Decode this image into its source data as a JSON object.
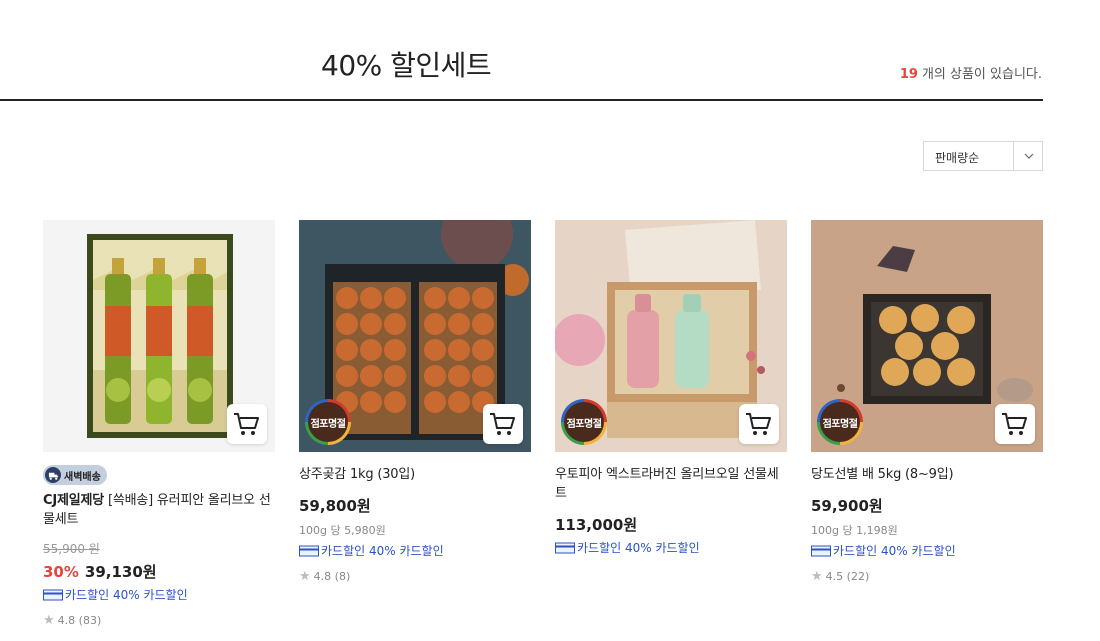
{
  "header": {
    "title": "40% 할인세트",
    "count": "19",
    "count_suffix": "개의 상품이 있습니다."
  },
  "sort": {
    "selected": "판매량순"
  },
  "colors": {
    "accent": "#e4463d",
    "promo": "#2a53c8"
  },
  "products": [
    {
      "image": "olive-oil-gift-set",
      "badge": "새벽배송",
      "brand": "CJ제일제당",
      "name": " [쓱배송] 유러피안 올리브오 선물세트",
      "original_price": "55,900 원",
      "discount_rate": "30%",
      "price": "39,130원",
      "promo": "카드할인 40% 카드할인",
      "rating": "4.8",
      "reviews": "(83)"
    },
    {
      "image": "dried-persimmon-box",
      "store_badge": "점포명절",
      "name": "상주곶감 1kg (30입)",
      "price": "59,800원",
      "unit_price": "100g 당 5,980원",
      "promo": "카드할인 40% 카드할인",
      "rating": "4.8",
      "reviews": "(8)"
    },
    {
      "image": "ootopia-olive-oil-set",
      "store_badge": "점포명절",
      "name": "우토피아 엑스트라버진 올리브오일 선물세트",
      "price": "113,000원",
      "promo": "카드할인 40% 카드할인"
    },
    {
      "image": "korean-pear-box",
      "store_badge": "점포명절",
      "name": "당도선별 배 5kg (8~9입)",
      "price": "59,900원",
      "unit_price": "100g 당 1,198원",
      "promo": "카드할인 40% 카드할인",
      "rating": "4.5",
      "reviews": "(22)"
    }
  ],
  "icons": {
    "cart": "cart-icon",
    "sort_chevron": "chevron-down-icon",
    "card": "credit-card-icon",
    "star": "star-icon",
    "truck": "truck-icon"
  }
}
